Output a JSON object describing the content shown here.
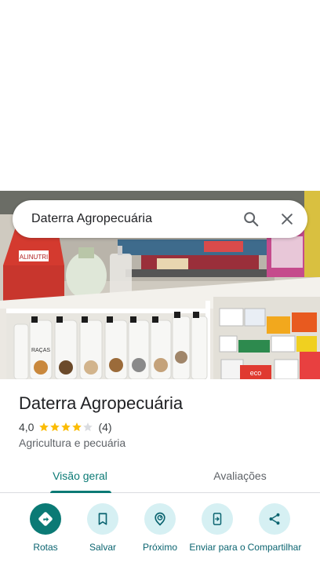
{
  "search": {
    "query": "Daterra Agropecuária",
    "search_icon": "search-icon",
    "close_icon": "close-icon"
  },
  "photo": {
    "store_sign_text": "ALINUTRI",
    "product_label": "RAÇAS",
    "box_label": "eco"
  },
  "place": {
    "name": "Daterra Agropecuária",
    "rating": "4,0",
    "rating_stars": 4,
    "rating_max": 5,
    "review_count": "(4)",
    "category": "Agricultura e pecuária"
  },
  "tabs": [
    {
      "label": "Visão geral",
      "active": true
    },
    {
      "label": "Avaliações",
      "active": false
    }
  ],
  "actions": [
    {
      "label": "Rotas",
      "icon": "directions-icon"
    },
    {
      "label": "Salvar",
      "icon": "bookmark-icon"
    },
    {
      "label": "Próximo",
      "icon": "nearby-icon"
    },
    {
      "label": "Enviar para o",
      "icon": "send-to-phone-icon"
    },
    {
      "label": "Compartilhar",
      "icon": "share-icon"
    }
  ],
  "colors": {
    "accent": "#0b7a75",
    "action_bg": "#d6f0f3",
    "star": "#fbbc04",
    "star_empty": "#dadce0"
  }
}
